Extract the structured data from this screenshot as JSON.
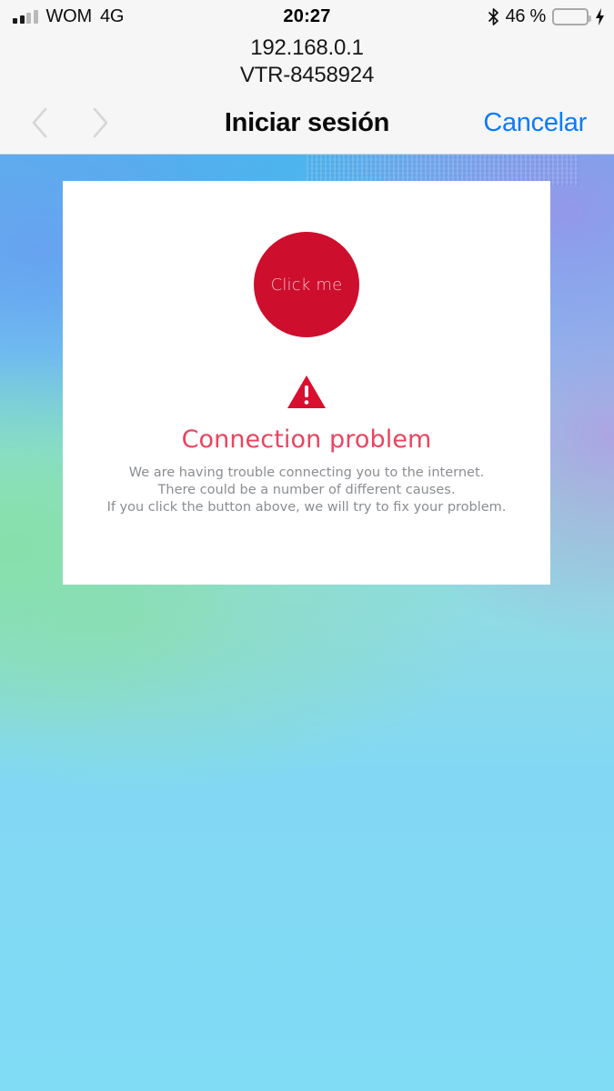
{
  "status_bar": {
    "carrier": "WOM",
    "network_type": "4G",
    "time": "20:27",
    "battery_percent_label": "46 %",
    "battery_level": 46,
    "signal_bars_filled": 2,
    "signal_bars_total": 4,
    "bluetooth_icon": "bluetooth-icon",
    "battery_icon": "battery-icon",
    "charging_icon": "lightning-bolt-icon",
    "battery_fill_color": "#fdc800"
  },
  "address": {
    "host": "192.168.0.1",
    "ssid": "VTR-8458924"
  },
  "nav_bar": {
    "back_icon": "chevron-left-icon",
    "forward_icon": "chevron-right-icon",
    "title": "Iniciar sesión",
    "cancel_label": "Cancelar",
    "cancel_color": "#0c7bf7",
    "disabled_chevron_color": "#d6d6d6"
  },
  "card": {
    "button": {
      "label": "Click me",
      "color": "#ce0e2d",
      "text_color": "rgba(255,255,255,0.72)"
    },
    "warning_icon": "warning-triangle-icon",
    "warning_icon_color": "#d80f2f",
    "error_title": "Connection problem",
    "error_title_color": "#e8455f",
    "error_body_lines": [
      "We are having trouble connecting you to the internet.",
      "There could be a number of different causes.",
      "If you click the button above, we will try to fix your problem."
    ],
    "error_body_color": "#8a8d92",
    "background_color": "#ffffff"
  },
  "background": {
    "top_left_color": "#62b2ea",
    "top_right_color": "#9696eb",
    "mid_left_color": "#86e0a8",
    "bottom_color": "#80dbf5"
  }
}
